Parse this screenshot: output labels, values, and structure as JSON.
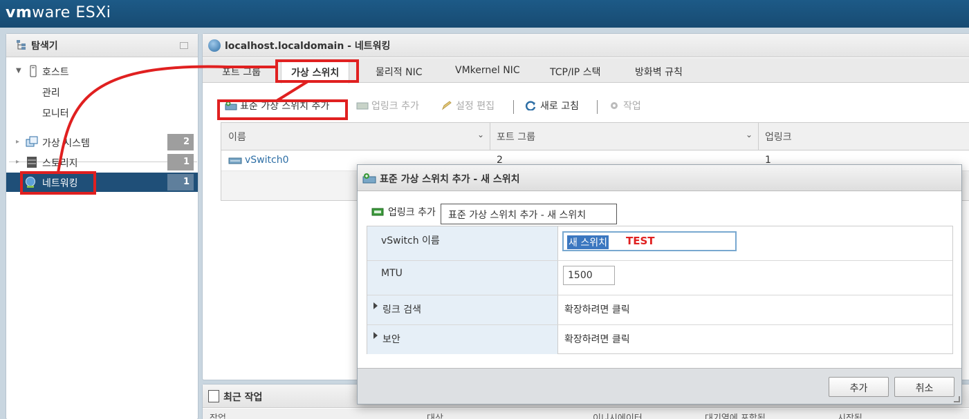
{
  "app": {
    "brand": "vm",
    "brand_rest": "ware",
    "product": "ESXi"
  },
  "navigator": {
    "title": "탐색기",
    "items": [
      {
        "label": "호스트",
        "icon": "host-icon"
      },
      {
        "label": "관리"
      },
      {
        "label": "모니터"
      },
      {
        "label": "가상 시스템",
        "icon": "vm-icon",
        "badge": "2"
      },
      {
        "label": "스토리지",
        "icon": "storage-icon",
        "badge": "1"
      },
      {
        "label": "네트워킹",
        "icon": "network-icon",
        "badge": "1",
        "selected": true
      }
    ]
  },
  "main": {
    "title": "localhost.localdomain - 네트워킹",
    "tabs": [
      "포트 그룹",
      "가상 스위치",
      "물리적 NIC",
      "VMkernel NIC",
      "TCP/IP 스택",
      "방화벽 규칙"
    ],
    "active_tab": "가상 스위치",
    "toolbar": {
      "add_switch": "표준 가상 스위치 추가",
      "add_uplink": "업링크 추가",
      "edit_settings": "설정 편집",
      "refresh": "새로 고침",
      "actions": "작업"
    },
    "table": {
      "columns": [
        "이름",
        "포트 그룹",
        "업링크"
      ],
      "rows": [
        {
          "name": "vSwitch0",
          "port_groups": "2",
          "uplinks": "1"
        }
      ]
    }
  },
  "recent_tasks": {
    "title": "최근 작업",
    "columns": [
      "작업",
      "대상",
      "이니시에이터",
      "대기열에 포함됨",
      "시작됨"
    ]
  },
  "dialog": {
    "title": "표준 가상 스위치 추가 - 새 스위치",
    "uplink_label": "업링크 추가",
    "tooltip": "표준 가상 스위치 추가 - 새 스위치",
    "fields": {
      "vswitch_name_label": "vSwitch 이름",
      "vswitch_name_value": "새 스위치",
      "annotation_text": "TEST",
      "mtu_label": "MTU",
      "mtu_value": "1500",
      "link_discovery_label": "링크 검색",
      "link_discovery_value": "확장하려면 클릭",
      "security_label": "보안",
      "security_value": "확장하려면 클릭"
    },
    "buttons": {
      "add": "추가",
      "cancel": "취소"
    }
  },
  "colors": {
    "header": "#1d5a87",
    "selected": "#1f4f78",
    "annotation": "#e02020",
    "link": "#2d6ea5"
  }
}
